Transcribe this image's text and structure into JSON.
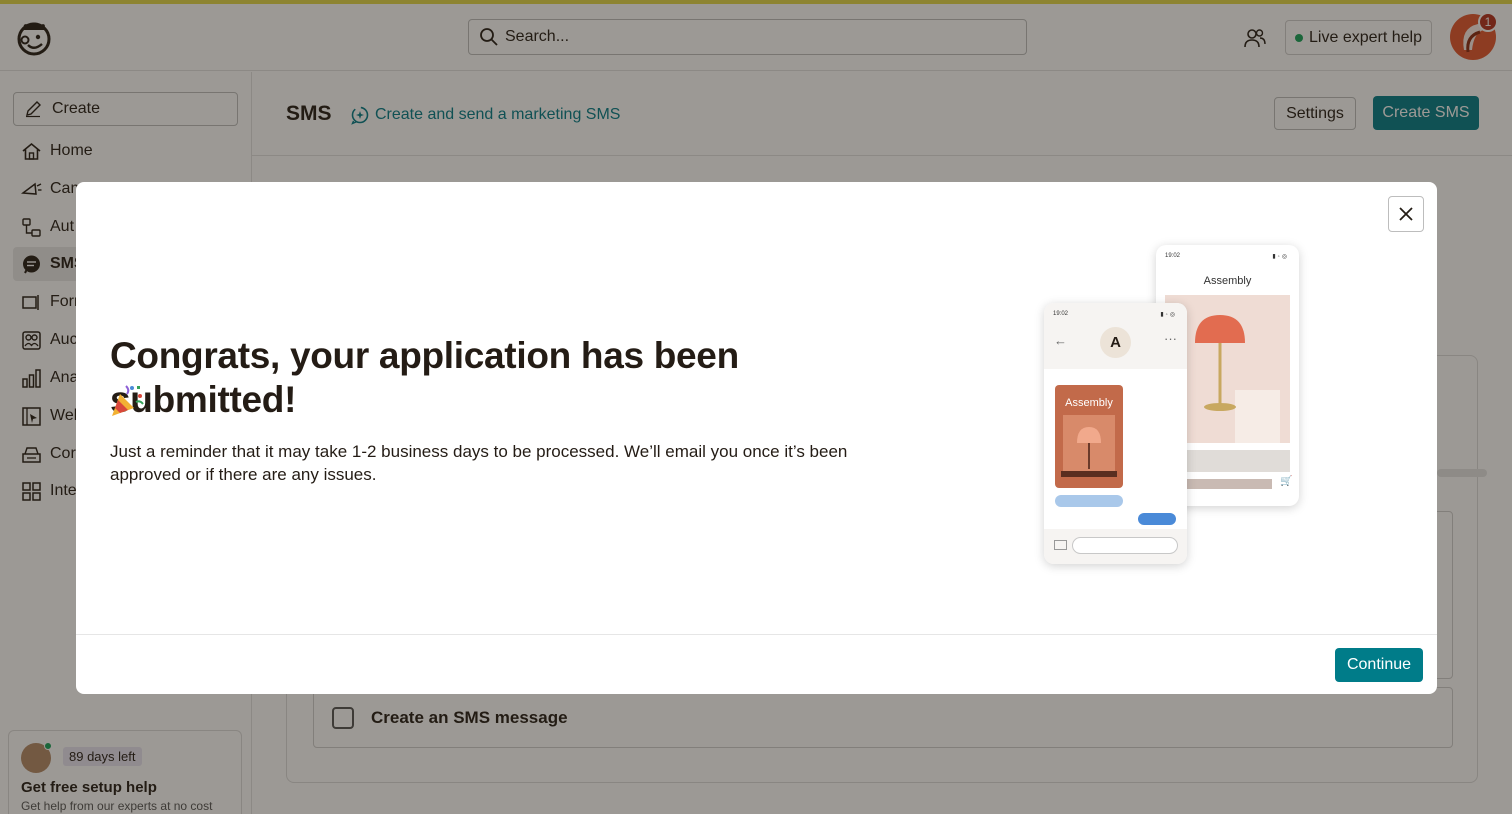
{
  "colors": {
    "accent_strip": "#e3d94a",
    "primary": "#007c89",
    "status_online": "#14a35a",
    "notification": "#b3301e"
  },
  "topbar": {
    "search_placeholder": "Search...",
    "live_help_label": "Live expert help",
    "notification_count": "1"
  },
  "sidebar": {
    "create_label": "Create",
    "items": [
      {
        "label": "Home",
        "icon": "home-icon"
      },
      {
        "label": "Cam",
        "icon": "megaphone-icon"
      },
      {
        "label": "Aut",
        "icon": "automation-icon"
      },
      {
        "label": "SMS",
        "icon": "sms-icon",
        "active": true
      },
      {
        "label": "Forr",
        "icon": "form-icon"
      },
      {
        "label": "Auc",
        "icon": "audience-icon"
      },
      {
        "label": "Ana",
        "icon": "analytics-icon"
      },
      {
        "label": "Wel",
        "icon": "website-icon"
      },
      {
        "label": "Cor",
        "icon": "content-icon"
      },
      {
        "label": "Inte",
        "icon": "integrations-icon"
      }
    ],
    "setup": {
      "days_left": "89 days left",
      "title": "Get free setup help",
      "subtitle": "Get help from our experts at no cost"
    }
  },
  "main": {
    "title": "SMS",
    "subtitle_link": "Create and send a marketing SMS",
    "settings_label": "Settings",
    "create_sms_label": "Create SMS",
    "task_label": "Create an SMS message"
  },
  "modal": {
    "title": "Congrats, your application has been submitted!",
    "body": "Just a reminder that it may take 1-2 business days to be processed. We’ll email you once it’s been approved or if there are any issues.",
    "continue_label": "Continue",
    "illustration": {
      "time": "19:02",
      "brand": "Assembly",
      "contact_initial": "A"
    }
  }
}
